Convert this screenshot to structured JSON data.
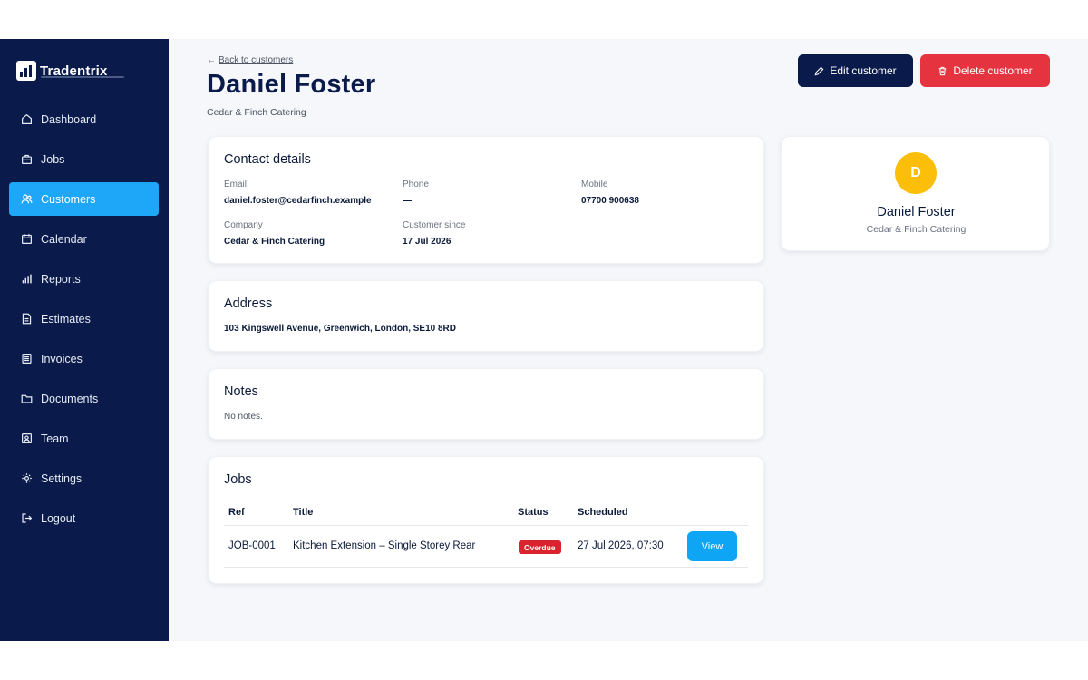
{
  "app": {
    "name": "Tradentrix"
  },
  "sidebar": {
    "items": [
      {
        "label": "Dashboard",
        "icon": "home-icon",
        "active": false
      },
      {
        "label": "Jobs",
        "icon": "briefcase-icon",
        "active": false
      },
      {
        "label": "Customers",
        "icon": "users-icon",
        "active": true
      },
      {
        "label": "Calendar",
        "icon": "calendar-icon",
        "active": false
      },
      {
        "label": "Reports",
        "icon": "bar-chart-icon",
        "active": false
      },
      {
        "label": "Estimates",
        "icon": "document-icon",
        "active": false
      },
      {
        "label": "Invoices",
        "icon": "receipt-icon",
        "active": false
      },
      {
        "label": "Documents",
        "icon": "folder-icon",
        "active": false
      },
      {
        "label": "Team",
        "icon": "team-icon",
        "active": false
      },
      {
        "label": "Settings",
        "icon": "gear-icon",
        "active": false
      },
      {
        "label": "Logout",
        "icon": "logout-icon",
        "active": false
      }
    ]
  },
  "header": {
    "back_label": "Back to customers",
    "title": "Daniel Foster",
    "subtitle": "Cedar & Finch Catering",
    "edit_label": "Edit customer",
    "delete_label": "Delete customer"
  },
  "contact": {
    "heading": "Contact details",
    "email_label": "Email",
    "email": "daniel.foster@cedarfinch.example",
    "phone_label": "Phone",
    "phone": "—",
    "mobile_label": "Mobile",
    "mobile": "07700 900638",
    "company_label": "Company",
    "company": "Cedar & Finch Catering",
    "since_label": "Customer since",
    "since": "17 Jul 2026"
  },
  "address": {
    "heading": "Address",
    "value": "103 Kingswell Avenue, Greenwich, London, SE10 8RD"
  },
  "notes": {
    "heading": "Notes",
    "value": "No notes."
  },
  "jobs": {
    "heading": "Jobs",
    "columns": [
      "Ref",
      "Title",
      "Status",
      "Scheduled"
    ],
    "rows": [
      {
        "ref": "JOB-0001",
        "title": "Kitchen Extension – Single Storey Rear",
        "status": "Overdue",
        "scheduled": "27 Jul 2026, 07:30",
        "action": "View"
      }
    ]
  },
  "profile": {
    "initial": "D",
    "name": "Daniel Foster",
    "company": "Cedar & Finch Catering"
  },
  "colors": {
    "sidebar_bg": "#0a1a4a",
    "accent": "#1ea7f8",
    "danger": "#e5343f",
    "avatar": "#fbbf0a"
  }
}
